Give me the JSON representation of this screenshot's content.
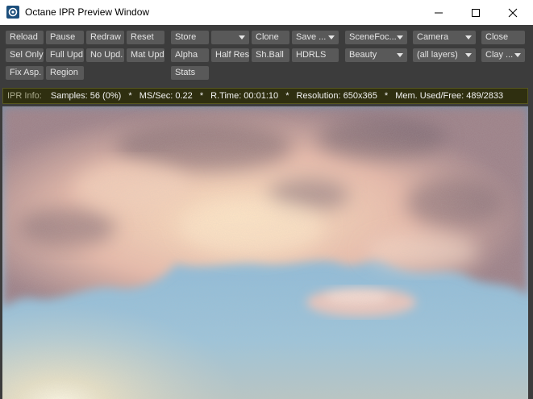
{
  "window": {
    "title": "Octane IPR Preview Window",
    "controls": {
      "minimize": "–",
      "maximize": "☐",
      "close": "✕"
    }
  },
  "toolbar": {
    "reload": "Reload",
    "pause": "Pause",
    "redraw": "Redraw",
    "reset": "Reset",
    "store": "Store",
    "store_slot": "",
    "clone": "Clone",
    "save": "Save ...",
    "scene_focus": "SceneFoc...",
    "camera": "Camera",
    "close": "Close",
    "sel_only": "Sel Only",
    "full_upd": "Full Upd.",
    "no_upd": "No Upd.",
    "mat_upd": "Mat Upd",
    "alpha": "Alpha",
    "half_res": "Half Res",
    "sh_ball": "Sh.Ball",
    "hdrls": "HDRLS",
    "beauty": "Beauty",
    "layers": "(all layers)",
    "clay": "Clay ...",
    "fix_asp": "Fix Asp.",
    "region": "Region",
    "stats": "Stats"
  },
  "info_bar": {
    "label": "IPR Info:",
    "items": [
      "Samples: 56 (0%)",
      "MS/Sec: 0.22",
      "R.Time: 00:01:10",
      "Resolution: 650x365",
      "Mem. Used/Free: 489/2833"
    ],
    "separator": "*"
  },
  "colors": {
    "panel_bg": "#3c3c3c",
    "button_bg": "#595959",
    "button_text": "#e4e4e4",
    "info_bg": "#2f2f10",
    "sky": "#8fb8d6",
    "cloud": "#f2cfc0"
  }
}
